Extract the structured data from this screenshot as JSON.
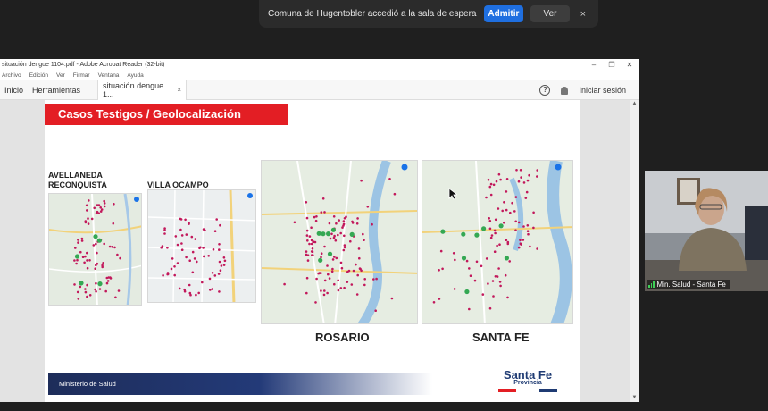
{
  "notification": {
    "message": "Comuna de Hugentobler accedió a la sala de espera",
    "admit_label": "Admitir",
    "view_label": "Ver",
    "close_glyph": "×"
  },
  "acrobat": {
    "title": "situación dengue 1104.pdf - Adobe Acrobat Reader (32-bit)",
    "window_controls": {
      "minimize": "–",
      "restore": "❐",
      "close": "✕"
    },
    "menu": [
      "Archivo",
      "Edición",
      "Ver",
      "Firmar",
      "Ventana",
      "Ayuda"
    ],
    "tabs": {
      "home": "Inicio",
      "tools": "Herramientas",
      "document": "situación dengue 1...",
      "document_close": "×"
    },
    "sign_in": "Iniciar sesión",
    "icons": [
      "help-icon",
      "bell-icon"
    ]
  },
  "slide": {
    "title": "Casos Testigos / Geolocalización",
    "labels": {
      "avellaneda_line1": "AVELLANEDA",
      "avellaneda_line2": "RECONQUISTA",
      "villa_ocampo": "VILLA OCAMPO",
      "rosario": "ROSARIO",
      "santa_fe": "SANTA FE"
    },
    "footer": "Ministerio de Salud",
    "logo": {
      "main": "Santa Fe",
      "sub": "Provincia"
    },
    "colors": {
      "title_bg": "#e31e24",
      "footer_bg": "#1e2d5a",
      "logo_red": "#e31e24",
      "logo_blue": "#1f3b73",
      "map_marker": "#c2185b",
      "map_green": "#34a853"
    }
  },
  "video": {
    "participant_name": "Min. Salud - Santa Fe",
    "icon": "signal-icon"
  }
}
